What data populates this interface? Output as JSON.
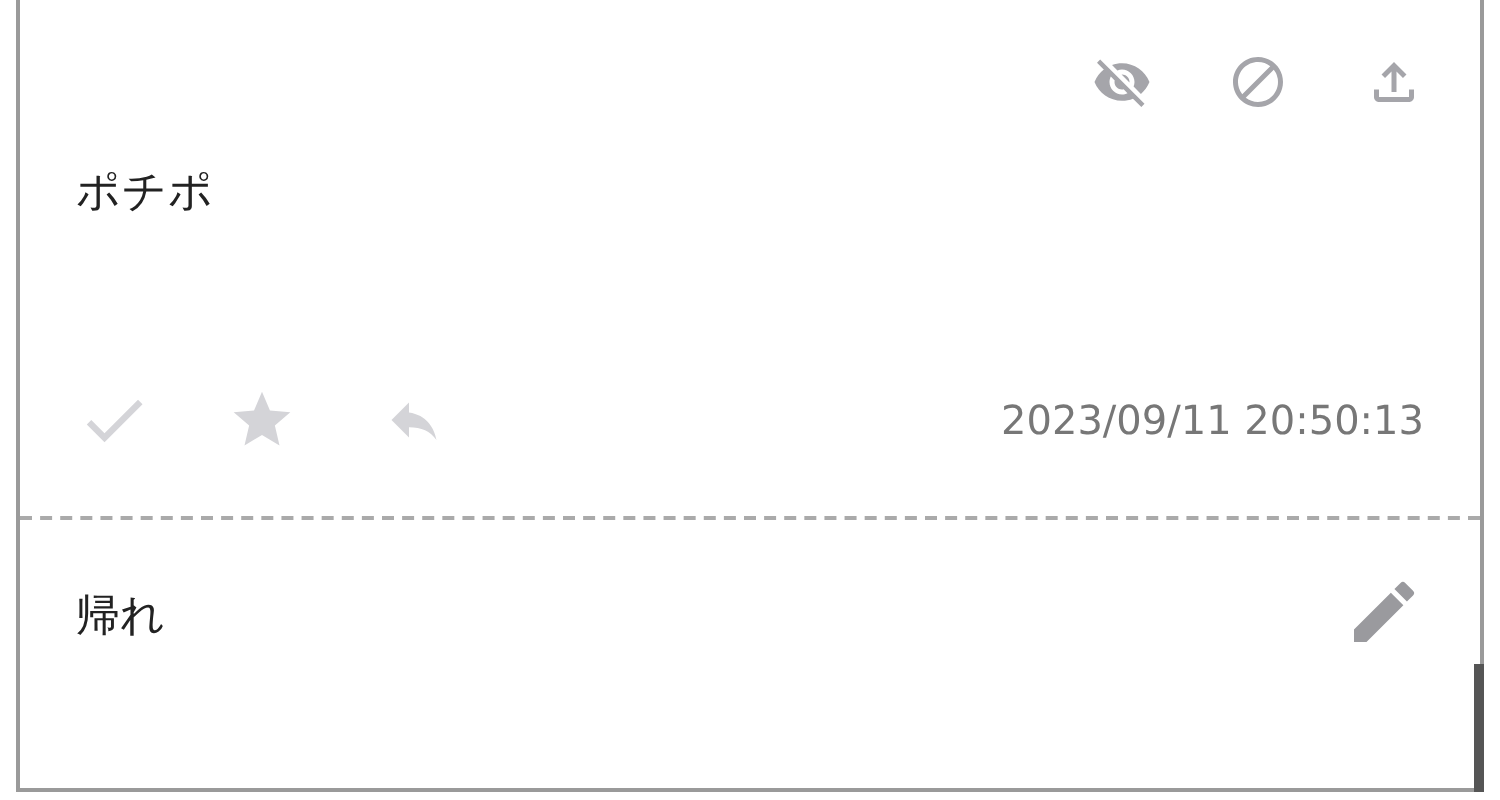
{
  "message": {
    "text": "ポチポ",
    "timestamp": "2023/09/11 20:50:13"
  },
  "reply": {
    "text": "帰れ"
  }
}
